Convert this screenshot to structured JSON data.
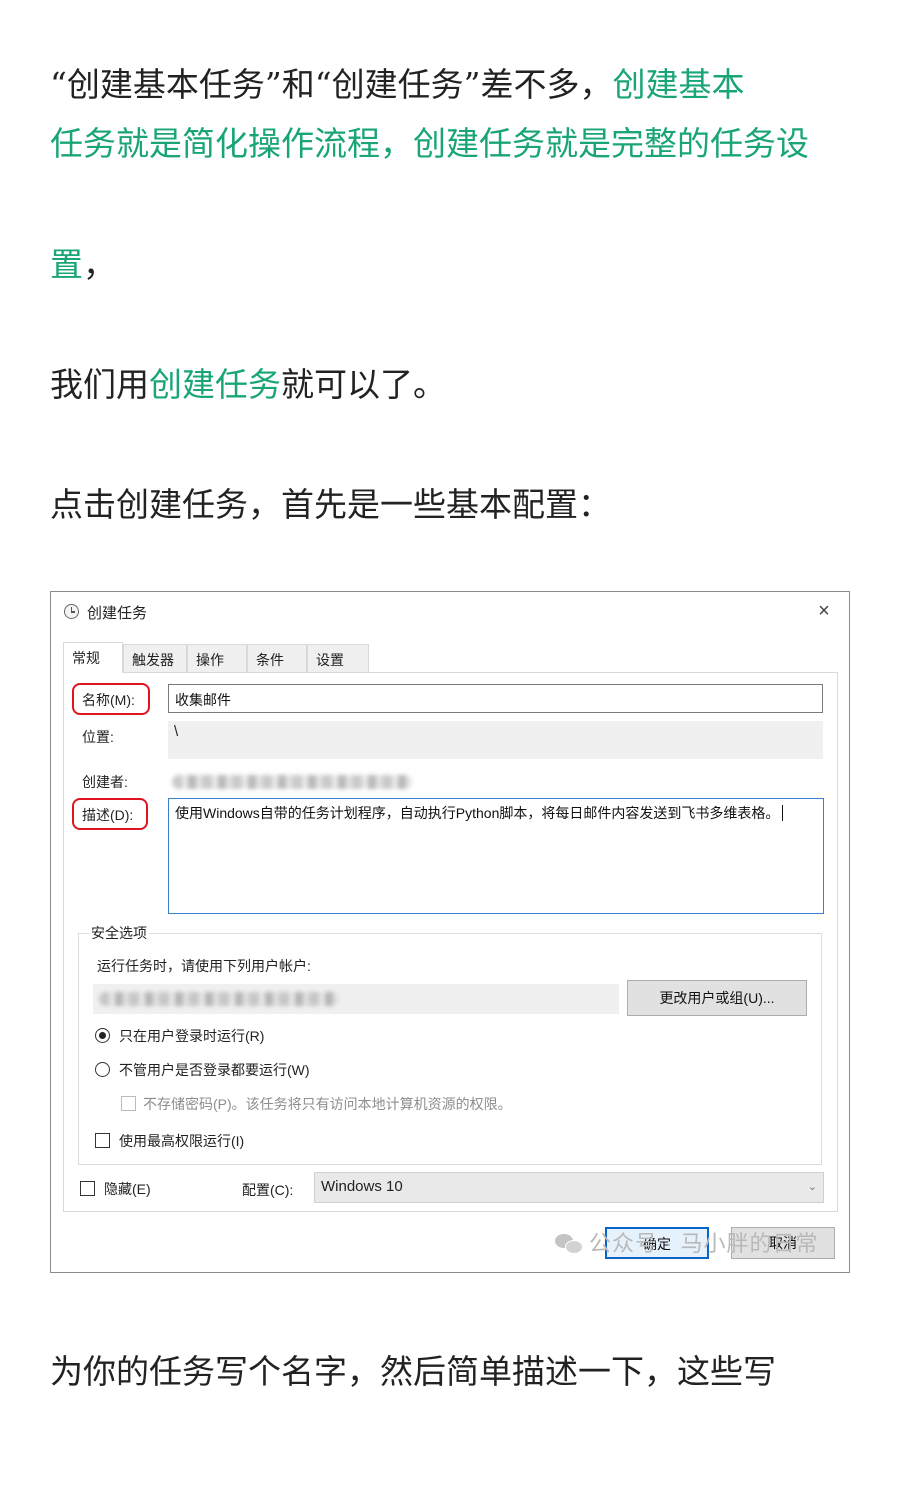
{
  "article": {
    "p1_part1": "“创建基本任务”和“创建任务”差不多，",
    "p1_link1": "创建基本",
    "p1_line2": "任务就是简化操作流程，创建任务就是完整的任务设",
    "p1_line3_hl": "置",
    "p1_line3_end": "，",
    "p2_start": "我们用",
    "p2_link": "创建任务",
    "p2_end": "就可以了。",
    "p3": "点击创建任务，首先是一些基本配置：",
    "p4": "为你的任务写个名字，然后简单描述一下，这些写"
  },
  "dialog": {
    "title": "创建任务",
    "close": "×",
    "tabs": [
      "常规",
      "触发器",
      "操作",
      "条件",
      "设置"
    ],
    "name_label": "名称(M):",
    "name_value": "收集邮件",
    "location_label": "位置:",
    "location_value": "\\",
    "author_label": "创建者:",
    "desc_label": "描述(D):",
    "desc_value": "使用Windows自带的任务计划程序，自动执行Python脚本，将每日邮件内容发送到飞书多维表格。",
    "security": {
      "title": "安全选项",
      "run_as_text": "运行任务时，请使用下列用户帐户:",
      "change_user_button": "更改用户或组(U)...",
      "opt_logged_on": "只在用户登录时运行(R)",
      "opt_whether_logged": "不管用户是否登录都要运行(W)",
      "opt_no_password": "不存储密码(P)。该任务将只有访问本地计算机资源的权限。",
      "opt_highest": "使用最高权限运行(I)"
    },
    "hidden_label": "隐藏(E)",
    "config_label": "配置(C):",
    "config_value": "Windows 10",
    "ok_button": "确定",
    "cancel_button": "取消"
  },
  "watermark": {
    "text": "公众号 · 马小胖的日常"
  }
}
